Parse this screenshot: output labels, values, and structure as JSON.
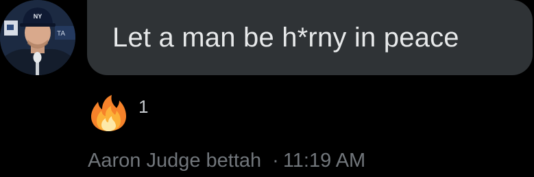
{
  "message": {
    "text": "Let a man be h*rny in peace",
    "bubble_color": "#2f3336",
    "text_color": "#e7e9ea"
  },
  "avatar": {
    "icon": "person-avatar-icon",
    "cap_logo_text": "NY"
  },
  "reaction": {
    "emoji_icon": "fire-emoji-icon",
    "count": "1"
  },
  "meta": {
    "sender_name": "Aaron Judge bettah",
    "separator": "·",
    "timestamp": "11:19 AM",
    "color": "#71767b"
  },
  "background_color": "#000000"
}
